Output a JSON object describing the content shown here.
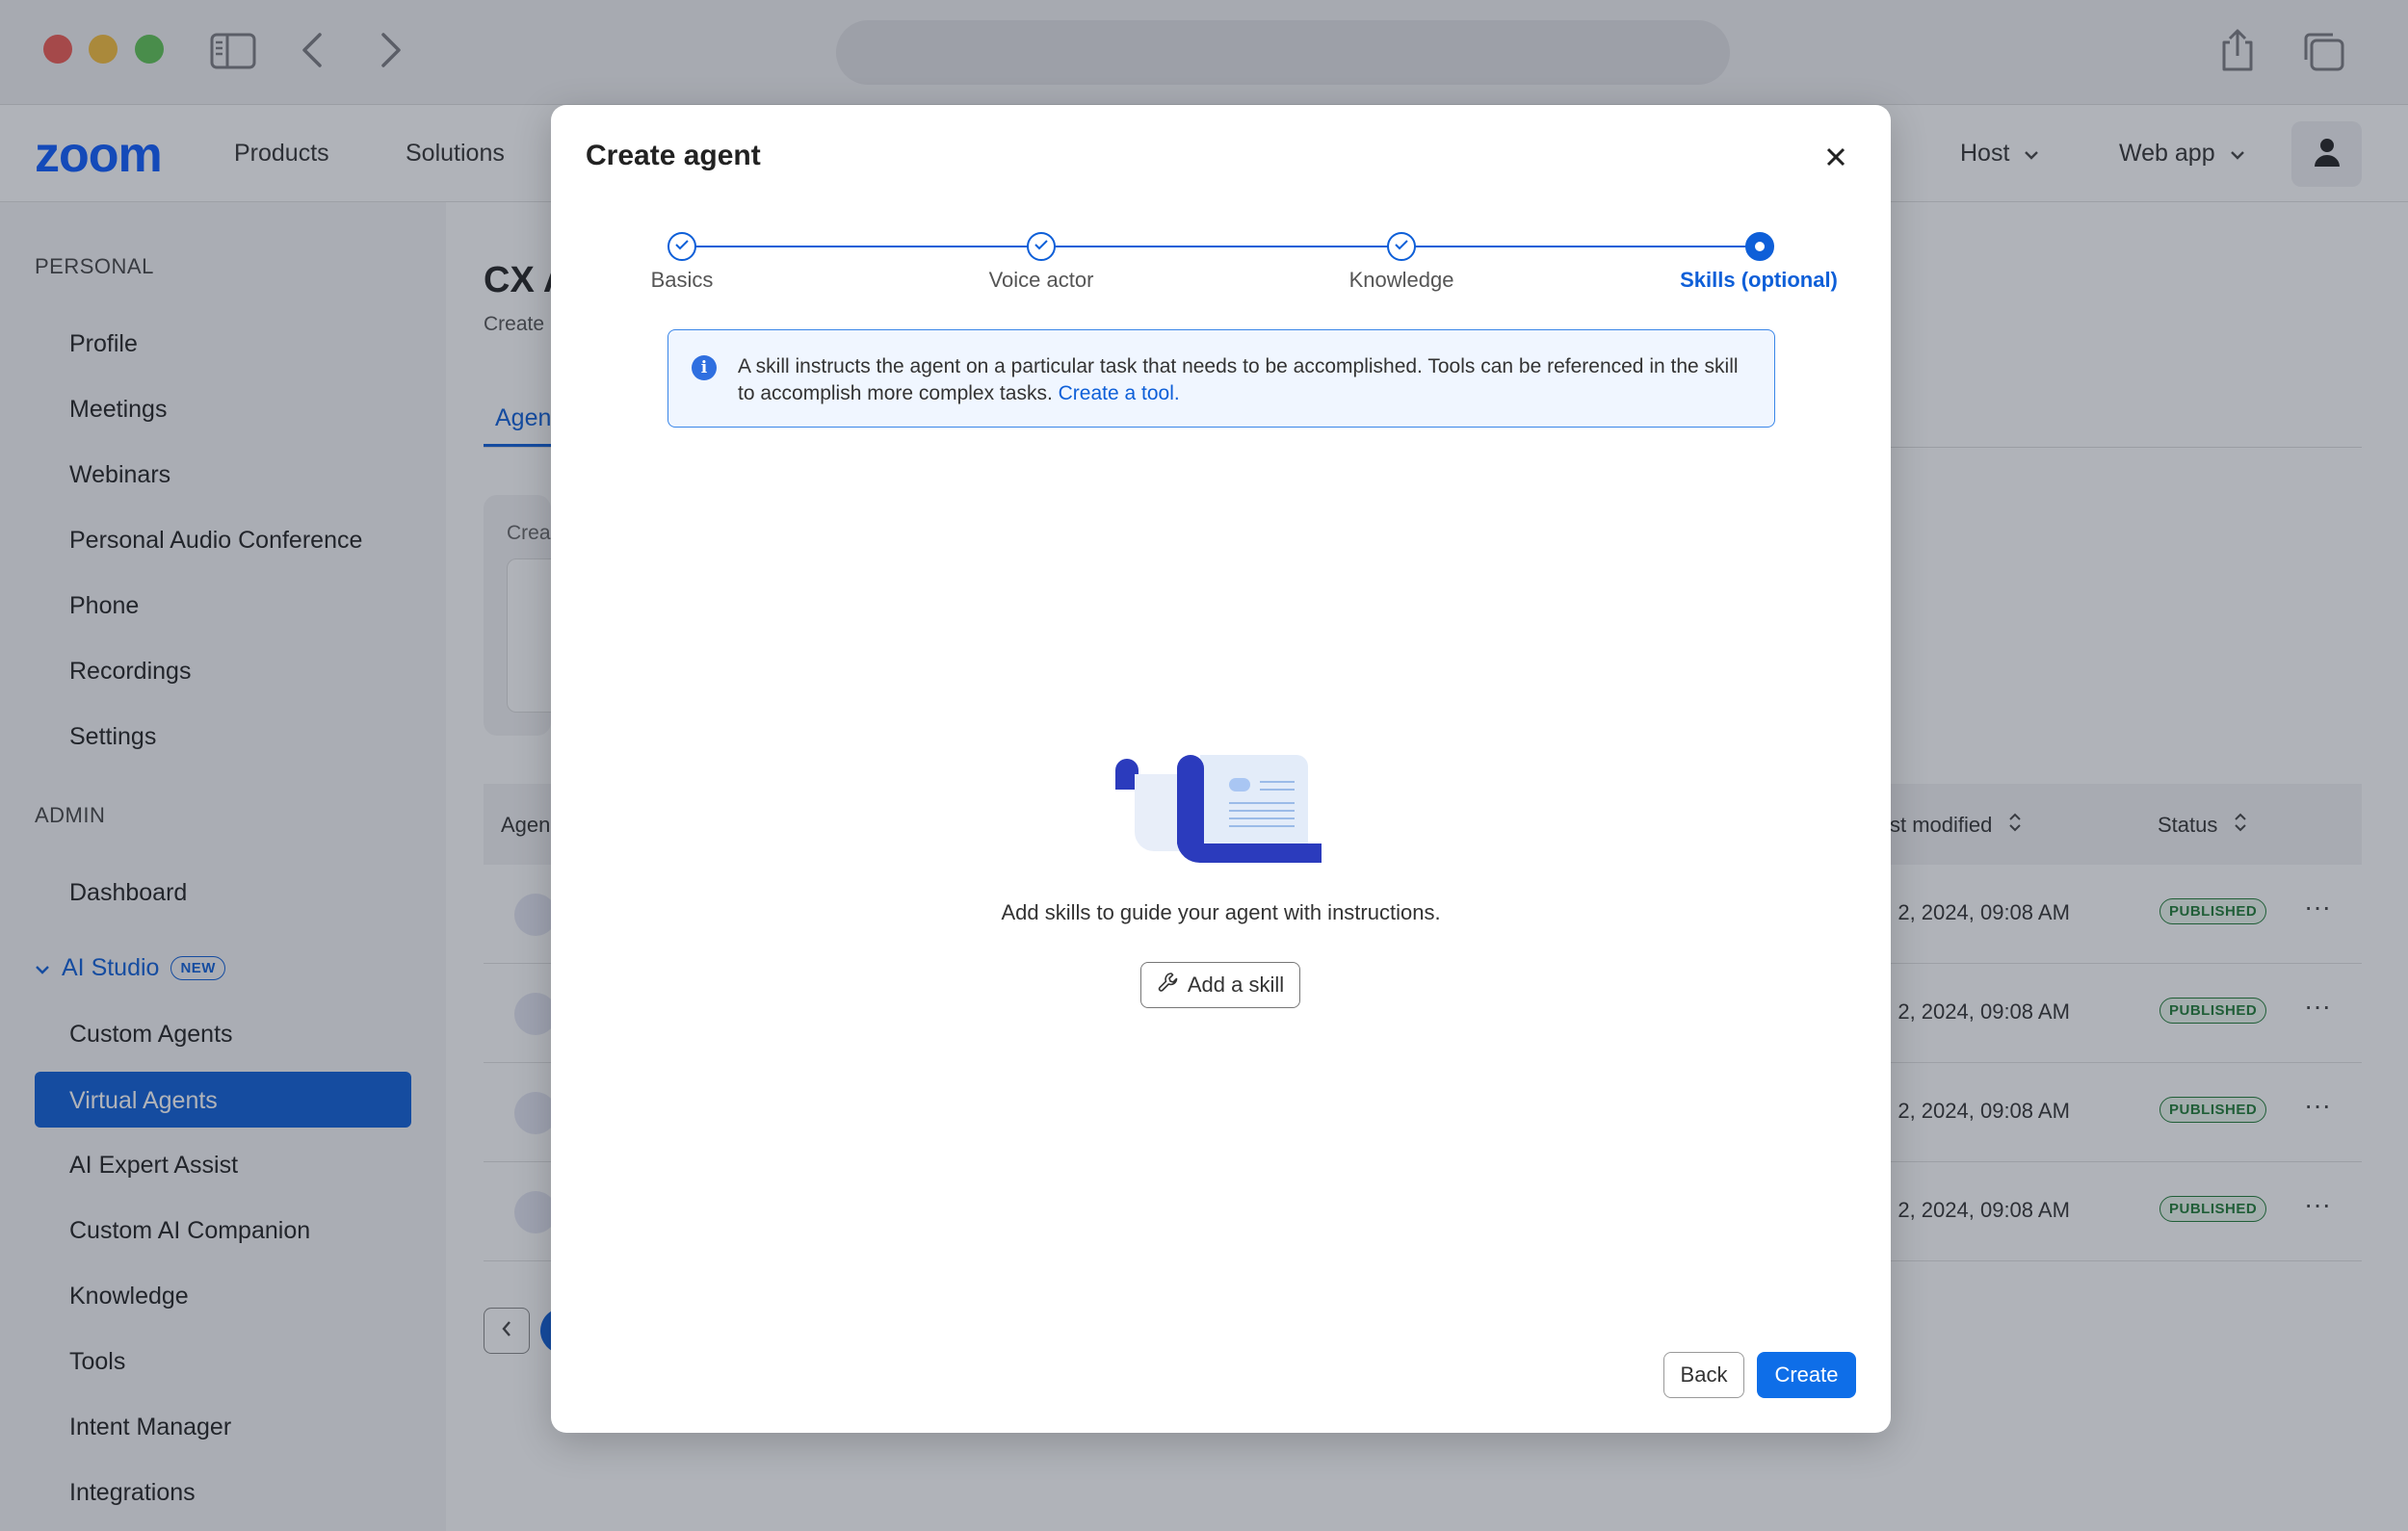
{
  "header": {
    "logo": "zoom",
    "nav": [
      "Products",
      "Solutions"
    ],
    "host_label": "Host",
    "webapp_label": "Web app"
  },
  "sidebar": {
    "personal_label": "PERSONAL",
    "personal_items": [
      "Profile",
      "Meetings",
      "Webinars",
      "Personal Audio Conference",
      "Phone",
      "Recordings",
      "Settings"
    ],
    "admin_label": "ADMIN",
    "dashboard": "Dashboard",
    "ai_studio": "AI Studio",
    "new_badge": "NEW",
    "ai_items": [
      "Custom Agents",
      "Virtual Agents",
      "AI Expert Assist",
      "Custom AI Companion",
      "Knowledge",
      "Tools",
      "Intent Manager",
      "Integrations"
    ],
    "active_item": "Virtual Agents"
  },
  "main": {
    "title": "CX A",
    "subtitle": "Create",
    "tab": "Agen",
    "create_card_title": "Crea",
    "table": {
      "col_agent": "Agen",
      "col_modified": "st modified",
      "col_status": "Status",
      "rows": [
        {
          "modified": "n 2, 2024, 09:08 AM",
          "status": "PUBLISHED"
        },
        {
          "modified": "n 2, 2024, 09:08 AM",
          "status": "PUBLISHED"
        },
        {
          "modified": "n 2, 2024, 09:08 AM",
          "status": "PUBLISHED"
        },
        {
          "modified": "n 2, 2024, 09:08 AM",
          "status": "PUBLISHED"
        }
      ]
    }
  },
  "modal": {
    "title": "Create agent",
    "steps": [
      {
        "label": "Basics",
        "state": "done"
      },
      {
        "label": "Voice actor",
        "state": "done"
      },
      {
        "label": "Knowledge",
        "state": "done"
      },
      {
        "label": "Skills (optional)",
        "state": "current"
      }
    ],
    "info_text": "A skill instructs the agent on a particular task that needs to be accomplished. Tools can be referenced in the skill to accomplish more complex tasks.",
    "info_link": "Create a tool.",
    "empty_text": "Add skills to guide your agent with instructions.",
    "add_skill_label": "Add a skill",
    "back_label": "Back",
    "create_label": "Create"
  },
  "colors": {
    "brand": "#0b5cff",
    "accent": "#0e5fd8",
    "published": "#1e7b35"
  }
}
